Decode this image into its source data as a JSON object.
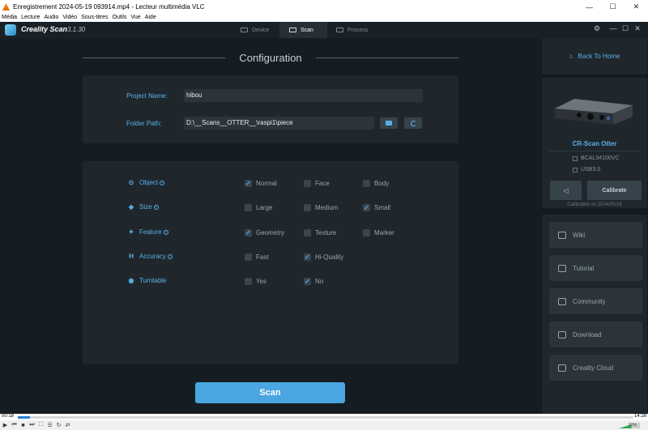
{
  "vlc": {
    "title": "Enregistrement 2024-05-19 093914.mp4 - Lecteur multimédia VLC",
    "menu": [
      "Média",
      "Lecture",
      "Audio",
      "Vidéo",
      "Sous-titres",
      "Outils",
      "Vue",
      "Aide"
    ],
    "time_elapsed": "00:18",
    "time_total": "14:28",
    "progress_fraction": 0.02,
    "volume": "60%"
  },
  "app": {
    "name": "Creality Scan",
    "version": "3.1.30",
    "tabs": [
      {
        "label": "Device",
        "active": false
      },
      {
        "label": "Scan",
        "active": true
      },
      {
        "label": "Process",
        "active": false
      }
    ]
  },
  "config": {
    "title": "Configuration",
    "project_name_label": "Project Name:",
    "project_name_value": "hibou",
    "folder_path_label": "Folder Path:",
    "folder_path_value": "D:\\__Scans__OTTER__\\raspi1\\piece",
    "options": [
      {
        "label": "Object",
        "icon": "target-icon",
        "choices": [
          {
            "label": "Normal",
            "checked": true
          },
          {
            "label": "Face",
            "checked": false
          },
          {
            "label": "Body",
            "checked": false
          }
        ]
      },
      {
        "label": "Size",
        "icon": "cube-icon",
        "choices": [
          {
            "label": "Large",
            "checked": false
          },
          {
            "label": "Medium",
            "checked": false
          },
          {
            "label": "Small",
            "checked": true
          }
        ]
      },
      {
        "label": "Feature",
        "icon": "feature-icon",
        "choices": [
          {
            "label": "Geometry",
            "checked": true
          },
          {
            "label": "Texture",
            "checked": false
          },
          {
            "label": "Marker",
            "checked": false
          }
        ]
      },
      {
        "label": "Accuracy",
        "icon": "accuracy-icon",
        "choices": [
          {
            "label": "Fast",
            "checked": false
          },
          {
            "label": "Hi-Quality",
            "checked": true
          }
        ]
      },
      {
        "label": "Turntable",
        "icon": "turntable-icon",
        "choices": [
          {
            "label": "Yes",
            "checked": false
          },
          {
            "label": "No",
            "checked": true
          }
        ]
      }
    ],
    "scan_button": "Scan"
  },
  "sidebar": {
    "back_label": "Back To Home",
    "device_name": "CR-Scan Otter",
    "serial": "BCAL34100VC",
    "port": "USB3.0",
    "calibrate_label": "Calibrate",
    "calibrated_on": "Calibrated on 2024/05/16",
    "links": [
      "Wiki",
      "Tutorial",
      "Community",
      "Download",
      "Creality Cloud"
    ]
  },
  "colors": {
    "accent": "#4aa6e0",
    "panel": "#1f272d",
    "background": "#161d22"
  }
}
